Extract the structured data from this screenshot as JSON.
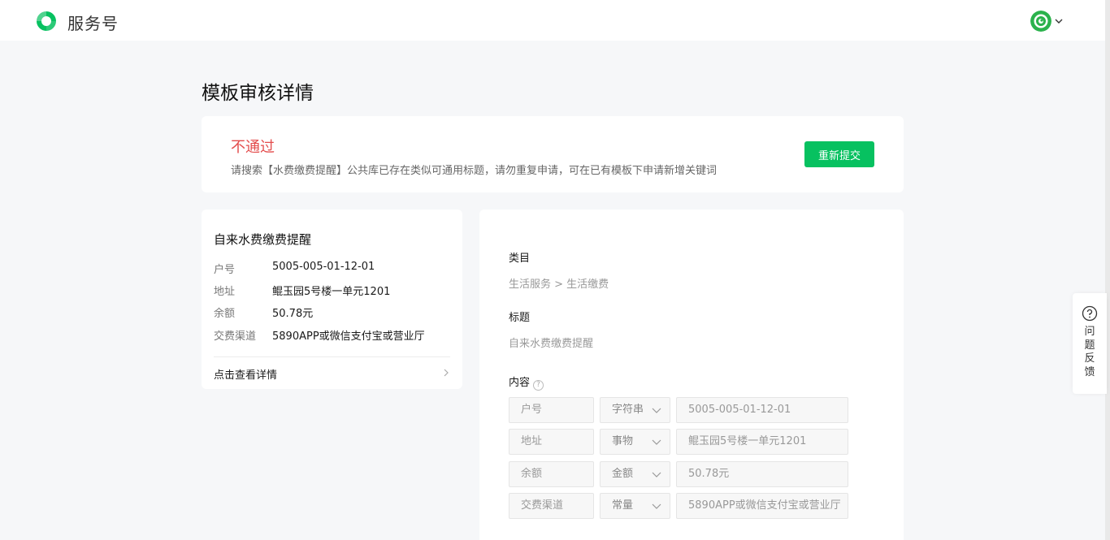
{
  "header": {
    "brand": "服务号",
    "logo_icon": "wechat-service-logo",
    "accent": "#07c160"
  },
  "page": {
    "title": "模板审核详情"
  },
  "status": {
    "result": "不通过",
    "result_color": "#e34d4d",
    "message": "请搜索【水费缴费提醒】公共库已存在类似可通用标题，请勿重复申请，可在已有模板下申请新增关键词",
    "resubmit_label": "重新提交"
  },
  "preview": {
    "title": "自来水费缴费提醒",
    "rows": [
      {
        "key": "户号",
        "value": "5005-005-01-12-01"
      },
      {
        "key": "地址",
        "value": "鲲玉园5号楼一单元1201"
      },
      {
        "key": "余额",
        "value": "50.78元"
      },
      {
        "key": "交费渠道",
        "value": "5890APP或微信支付宝或营业厅"
      }
    ],
    "detail_link": "点击查看详情"
  },
  "info": {
    "category_label": "类目",
    "category_value": "生活服务 > 生活缴费",
    "title_label": "标题",
    "title_value": "自来水费缴费提醒",
    "content_label": "内容",
    "help_glyph": "?",
    "fields": [
      {
        "name": "户号",
        "type": "字符串",
        "value": "5005-005-01-12-01"
      },
      {
        "name": "地址",
        "type": "事物",
        "value": "鲲玉园5号楼一单元1201"
      },
      {
        "name": "余额",
        "type": "金额",
        "value": "50.78元"
      },
      {
        "name": "交费渠道",
        "type": "常量",
        "value": "5890APP或微信支付宝或营业厅"
      }
    ]
  },
  "feedback": {
    "label": "问题反馈",
    "icon": "question-circle-icon"
  }
}
